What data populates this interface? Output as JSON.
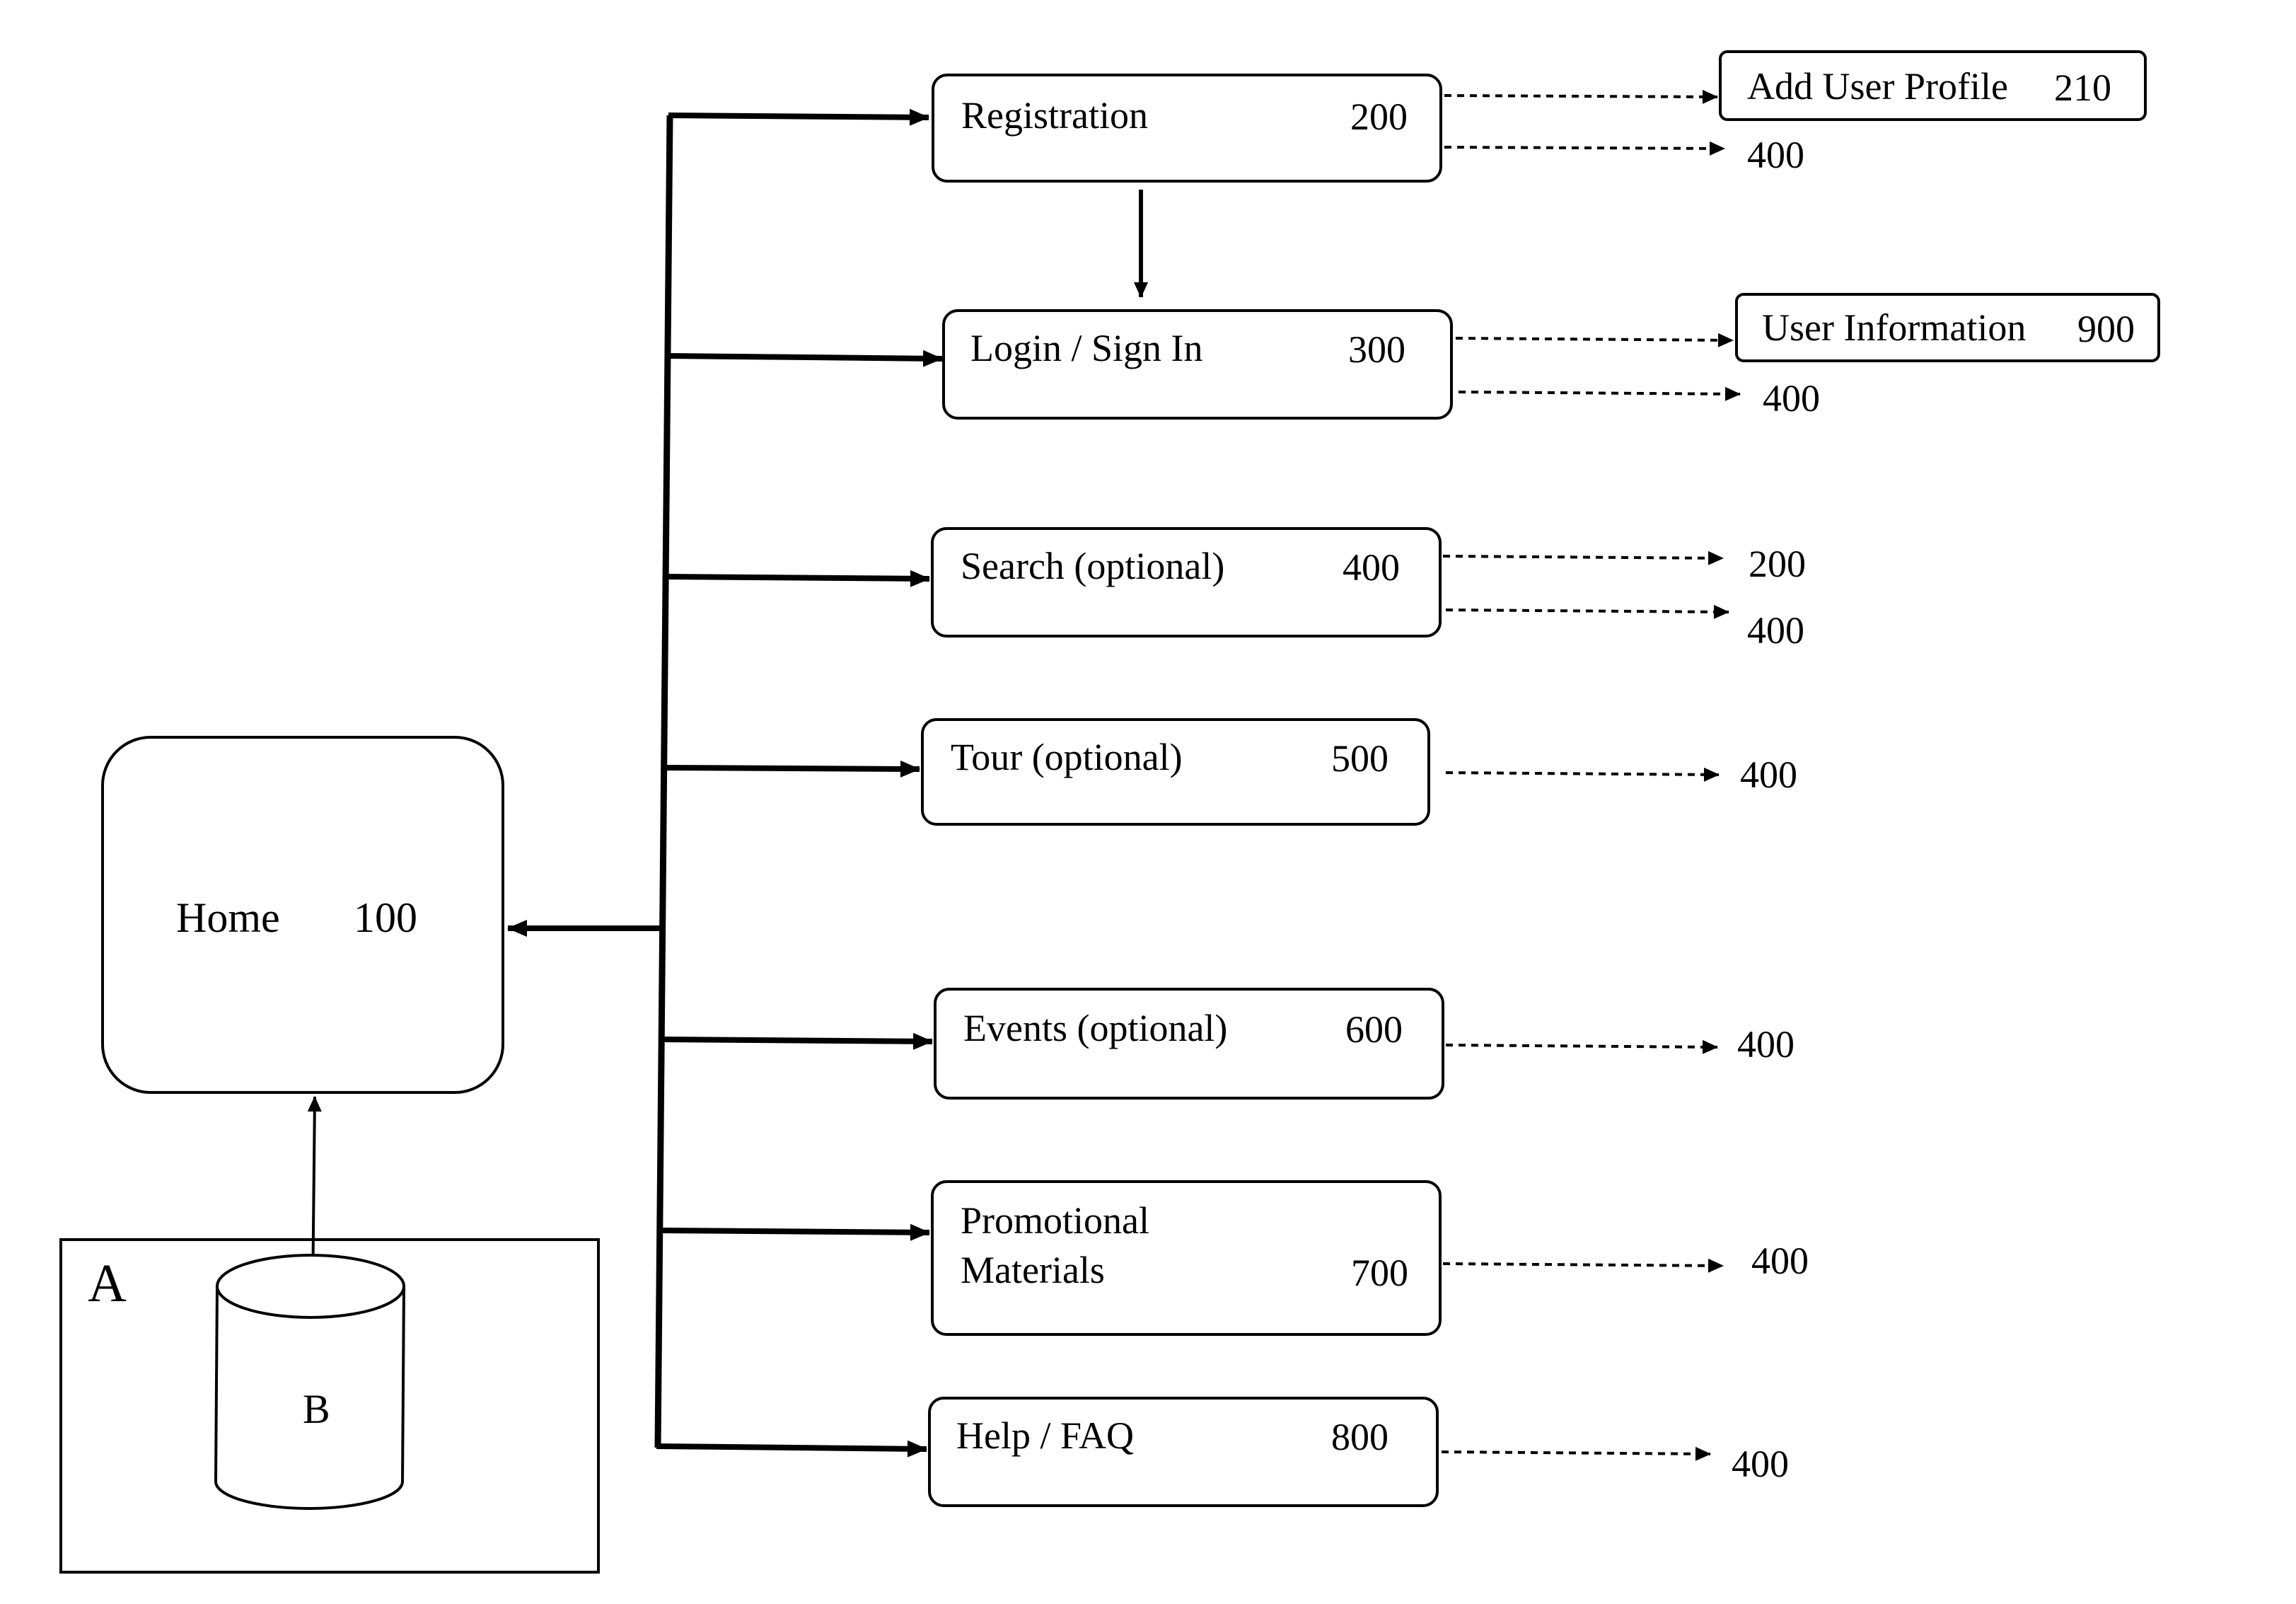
{
  "home": {
    "label": "Home",
    "number": "100"
  },
  "container": {
    "label": "A"
  },
  "database": {
    "label": "B"
  },
  "nodes": [
    {
      "label": "Registration",
      "number": "200"
    },
    {
      "label": "Login / Sign In",
      "number": "300"
    },
    {
      "label": "Search (optional)",
      "number": "400"
    },
    {
      "label": "Tour (optional)",
      "number": "500"
    },
    {
      "label": "Events (optional)",
      "number": "600"
    },
    {
      "label_line1": "Promotional",
      "label_line2": "Materials",
      "number": "700"
    },
    {
      "label": "Help / FAQ",
      "number": "800"
    }
  ],
  "side_boxes": {
    "add_user_profile": {
      "label": "Add User Profile",
      "number": "210"
    },
    "user_information": {
      "label": "User Information",
      "number": "900"
    }
  },
  "refs": {
    "registration_to_400": "400",
    "login_to_400": "400",
    "search_to_200": "200",
    "search_to_400": "400",
    "tour_to_400": "400",
    "events_to_400": "400",
    "promo_to_400": "400",
    "help_to_400": "400"
  }
}
